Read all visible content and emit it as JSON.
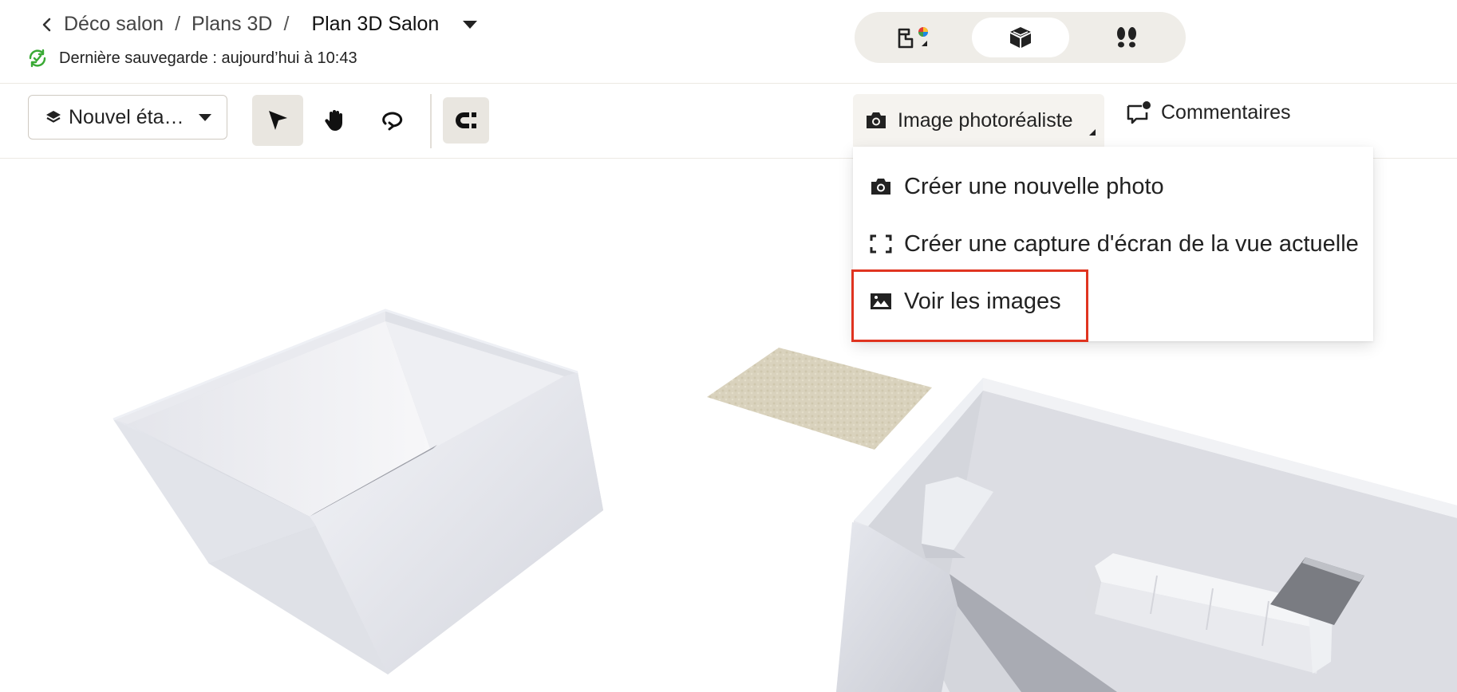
{
  "header": {
    "breadcrumb": {
      "project": "Déco salon",
      "section": "Plans 3D",
      "separator": "/",
      "current": "Plan 3D Salon"
    },
    "save_status": "Dernière sauvegarde : aujourd’hui à 10:43",
    "view_modes": [
      {
        "icon": "floorplan-2d-icon",
        "active": false
      },
      {
        "icon": "cube-3d-icon",
        "active": true
      },
      {
        "icon": "footsteps-icon",
        "active": false
      }
    ]
  },
  "toolbar": {
    "level_select": "Nouvel éta…",
    "tools": [
      {
        "icon": "pointer-icon",
        "active": true
      },
      {
        "icon": "hand-icon",
        "active": false
      },
      {
        "icon": "rotate-icon",
        "active": false
      },
      {
        "icon": "magnet-icon",
        "active": true
      }
    ],
    "photo_button": "Image photoréaliste",
    "comments_button": "Commentaires"
  },
  "photo_menu": {
    "items": [
      {
        "label": "Créer une nouvelle photo",
        "icon": "camera-icon"
      },
      {
        "label": "Créer une capture d'écran de la vue actuelle",
        "icon": "screenshot-frame-icon"
      },
      {
        "label": "Voir les images",
        "icon": "image-icon",
        "highlighted": true
      }
    ]
  },
  "colors": {
    "highlight": "#e03420",
    "success": "#3aaa35",
    "toggle_bg": "#efede8",
    "active_tool_bg": "#e9e6e0"
  }
}
